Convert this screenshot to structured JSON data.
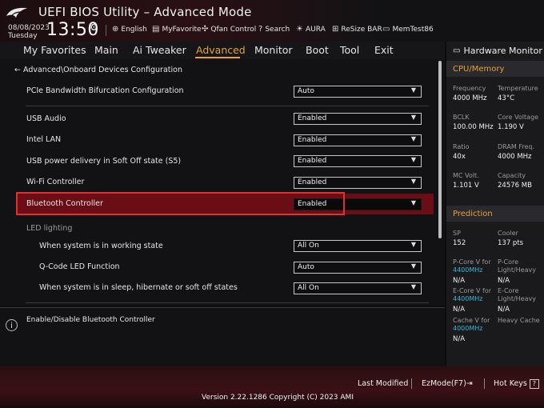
{
  "header": {
    "app_title": "UEFI BIOS Utility – Advanced Mode",
    "date": "08/08/2023",
    "day": "Tuesday",
    "time": "13:50",
    "items": [
      {
        "label": "English",
        "icon": "globe-icon"
      },
      {
        "label": "MyFavorite",
        "icon": "favorite-icon"
      },
      {
        "label": "Qfan Control",
        "icon": "fan-icon"
      },
      {
        "label": "Search",
        "icon": "search-icon"
      },
      {
        "label": "AURA",
        "icon": "aura-icon"
      },
      {
        "label": "ReSize BAR",
        "icon": "resize-bar-icon"
      },
      {
        "label": "MemTest86",
        "icon": "memtest-icon"
      }
    ]
  },
  "tabs": [
    "My Favorites",
    "Main",
    "Ai Tweaker",
    "Advanced",
    "Monitor",
    "Boot",
    "Tool",
    "Exit"
  ],
  "active_tab": "Advanced",
  "breadcrumb": "Advanced\\Onboard Devices Configuration",
  "settings": [
    {
      "label": "PCIe Bandwidth Bifurcation Configuration",
      "value": "Auto"
    },
    {
      "label": "USB Audio",
      "value": "Enabled"
    },
    {
      "label": "Intel LAN",
      "value": "Enabled"
    },
    {
      "label": "USB power delivery in Soft Off state (S5)",
      "value": "Enabled"
    },
    {
      "label": "Wi-Fi Controller",
      "value": "Enabled"
    },
    {
      "label": "Bluetooth Controller",
      "value": "Enabled"
    }
  ],
  "led_section": {
    "label": "LED lighting",
    "items": [
      {
        "label": "When system is in working state",
        "value": "All On"
      },
      {
        "label": "Q-Code LED Function",
        "value": "Auto"
      },
      {
        "label": "When system is in sleep, hibernate or soft off states",
        "value": "All On"
      }
    ]
  },
  "help_text": "Enable/Disable Bluetooth Controller",
  "hw_monitor": {
    "title": "Hardware Monitor",
    "cpu_section": "CPU/Memory",
    "cpu": [
      {
        "key": "Frequency",
        "value": "4000 MHz",
        "key2": "Temperature",
        "value2": "43°C"
      },
      {
        "key": "BCLK",
        "value": "100.00 MHz",
        "key2": "Core Voltage",
        "value2": "1.190 V"
      },
      {
        "key": "Ratio",
        "value": "40x",
        "key2": "DRAM Freq.",
        "value2": "4000 MHz"
      },
      {
        "key": "MC Volt.",
        "value": "1.101 V",
        "key2": "Capacity",
        "value2": "24576 MB"
      }
    ],
    "prediction_section": "Prediction",
    "sp_key": "SP",
    "sp_value": "152",
    "cooler_key": "Cooler",
    "cooler_value": "137 pts",
    "pcore_v_key": "P-Core V for",
    "pcore_v_freq": "4400MHz",
    "pcore_v_value": "N/A",
    "pcore_lh_key1": "P-Core",
    "pcore_lh_key2": "Light/Heavy",
    "pcore_lh_value": "N/A",
    "ecore_v_key": "E-Core V for",
    "ecore_v_freq": "4400MHz",
    "ecore_v_value": "N/A",
    "ecore_lh_key1": "E-Core",
    "ecore_lh_key2": "Light/Heavy",
    "ecore_lh_value": "N/A",
    "cache_v_key": "Cache V for",
    "cache_v_freq": "4000MHz",
    "cache_v_value": "N/A",
    "heavy_cache_key": "Heavy Cache"
  },
  "footer": {
    "last_modified": "Last Modified",
    "ezmode": "EzMode(F7)",
    "hotkeys": "Hot Keys",
    "hotkeys_glyph": "?",
    "version": "Version 2.22.1286 Copyright (C) 2023 AMI"
  },
  "colors": {
    "accent": "#e6a13a",
    "highlight": "#6a0d15",
    "selection_border": "#e03030",
    "freq_blue": "#36b7d6"
  }
}
